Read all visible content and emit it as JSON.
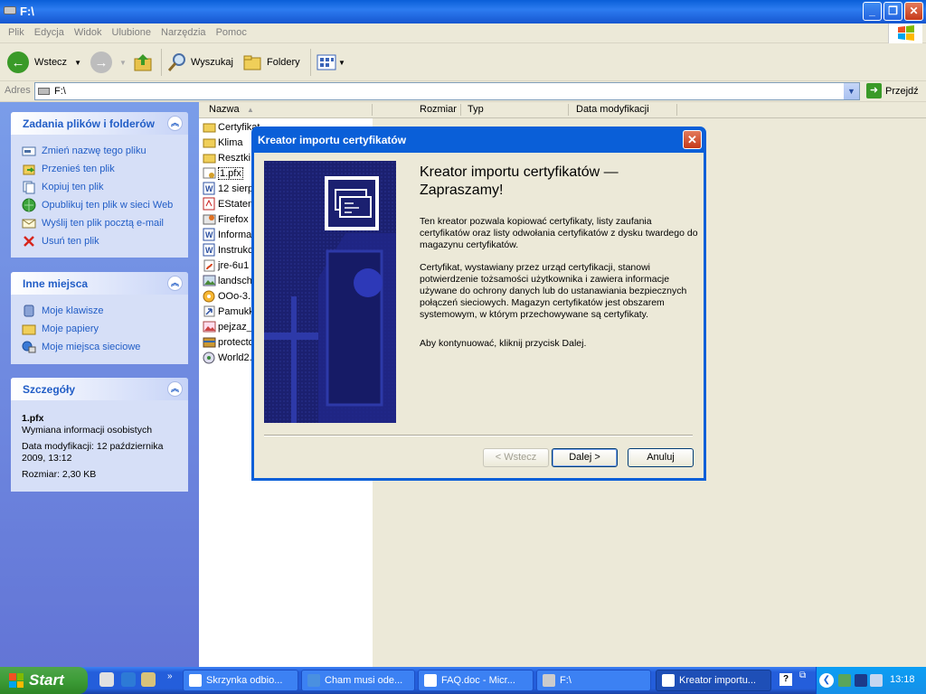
{
  "window": {
    "title": "F:\\"
  },
  "menu": [
    "Plik",
    "Edycja",
    "Widok",
    "Ulubione",
    "Narzędzia",
    "Pomoc"
  ],
  "toolbar": {
    "back": "Wstecz",
    "search": "Wyszukaj",
    "folders": "Foldery"
  },
  "address": {
    "label": "Adres",
    "value": "F:\\",
    "go": "Przejdź"
  },
  "panels": {
    "tasks": {
      "title": "Zadania plików i folderów",
      "items": [
        "Zmień nazwę tego pliku",
        "Przenieś ten plik",
        "Kopiuj ten plik",
        "Opublikuj ten plik w sieci Web",
        "Wyślij ten plik pocztą e-mail",
        "Usuń ten plik"
      ]
    },
    "places": {
      "title": "Inne miejsca",
      "items": [
        "Moje klawisze",
        "Moje papiery",
        "Moje miejsca sieciowe"
      ]
    },
    "details": {
      "title": "Szczegóły",
      "name": "1.pfx",
      "type": "Wymiana informacji osobistych",
      "modified": "Data modyfikacji: 12 października 2009, 13:12",
      "size": "Rozmiar: 2,30 KB"
    }
  },
  "columns": {
    "name": "Nazwa",
    "size": "Rozmiar",
    "type": "Typ",
    "modified": "Data modyfikacji"
  },
  "files": [
    "Certyfikat",
    "Klima",
    "Resztki",
    "1.pfx",
    "12 sierp",
    "EStaten",
    "Firefox",
    "Informa",
    "Instrukc",
    "jre-6u1",
    "landsch",
    "OOo-3.",
    "Pamukk",
    "pejzaz_",
    "protecto",
    "World2."
  ],
  "dialog": {
    "title": "Kreator importu certyfikatów",
    "heading": "Kreator importu certyfikatów — Zapraszamy!",
    "p1": "Ten kreator pozwala kopiować certyfikaty, listy zaufania certyfikatów oraz listy odwołania certyfikatów z dysku twardego do magazynu certyfikatów.",
    "p2": "Certyfikat, wystawiany przez urząd certyfikacji, stanowi potwierdzenie tożsamości użytkownika i zawiera informacje używane do ochrony danych lub do ustanawiania bezpiecznych połączeń sieciowych. Magazyn certyfikatów jest obszarem systemowym, w którym przechowywane są certyfikaty.",
    "p3": "Aby kontynuować, kliknij przycisk Dalej.",
    "back": "< Wstecz",
    "next": "Dalej >",
    "cancel": "Anuluj"
  },
  "taskbar": {
    "start": "Start",
    "tasks": [
      "Skrzynka odbio...",
      "Cham musi ode...",
      "FAQ.doc - Micr...",
      "F:\\",
      "Kreator importu..."
    ],
    "time": "13:18"
  }
}
